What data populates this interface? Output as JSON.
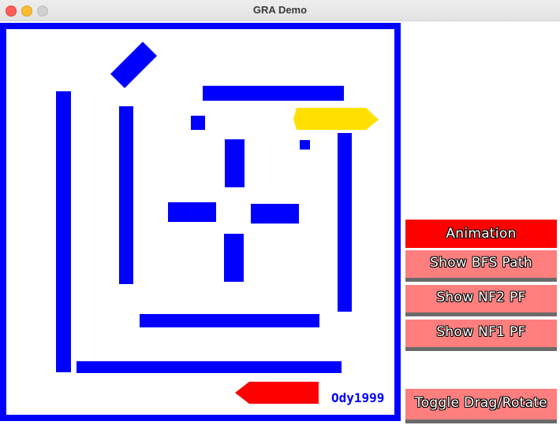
{
  "window": {
    "title": "GRA Demo"
  },
  "canvas": {
    "signature": "Ody1999",
    "colors": {
      "wall": "#0000ff",
      "yellow_block": "#ffe000",
      "red_block": "#ff0000",
      "background": "#ffffff"
    }
  },
  "buttons": {
    "animation": "Animation",
    "show_bfs": "Show BFS Path",
    "show_nf2": "Show NF2 PF",
    "show_nf1": "Show NF1 PF",
    "toggle": "Toggle Drag/Rotate"
  },
  "colors": {
    "button_active": "#ff0000",
    "button_normal": "#ff7f7f",
    "button_shadow": "#6a6a6a"
  }
}
